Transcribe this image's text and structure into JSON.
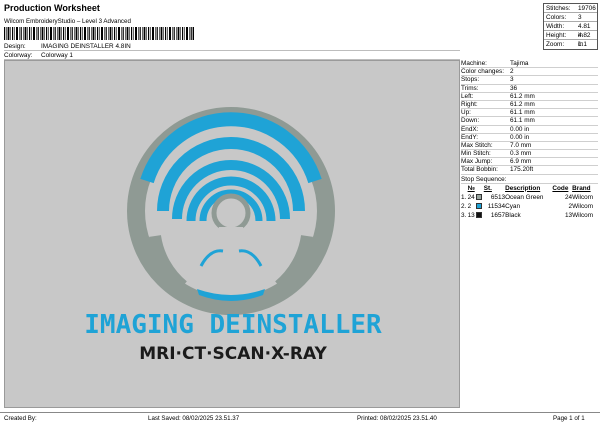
{
  "header": {
    "title": "Production Worksheet",
    "subtitle": "Wilcom EmbroideryStudio – Level 3 Advanced"
  },
  "info": {
    "design_label": "Design:",
    "design_value": "IMAGING DEINSTALLER 4.8IN",
    "colorway_label": "Colorway:",
    "colorway_value": "Colorway 1"
  },
  "stats": [
    {
      "label": "Stitches:",
      "value": "19706"
    },
    {
      "label": "Colors:",
      "value": "3"
    },
    {
      "label": "Width:",
      "value": "4.81 in"
    },
    {
      "label": "Height:",
      "value": "4.82 in"
    },
    {
      "label": "Zoom:",
      "value": "1:1"
    }
  ],
  "machine": [
    {
      "label": "Machine:",
      "value": "Tajima"
    },
    {
      "label": "Color changes:",
      "value": "2"
    },
    {
      "label": "Stops:",
      "value": "3"
    },
    {
      "label": "Trims:",
      "value": "36"
    },
    {
      "label": "Left:",
      "value": "61.2 mm"
    },
    {
      "label": "Right:",
      "value": "61.2 mm"
    },
    {
      "label": "Up:",
      "value": "61.1 mm"
    },
    {
      "label": "Down:",
      "value": "61.1 mm"
    },
    {
      "label": "EndX:",
      "value": "0.00 in"
    },
    {
      "label": "EndY:",
      "value": "0.00 in"
    },
    {
      "label": "Max Stitch:",
      "value": "7.0 mm"
    },
    {
      "label": "Min Stitch:",
      "value": "0.3 mm"
    },
    {
      "label": "Max Jump:",
      "value": "6.9 mm"
    },
    {
      "label": "Total Bobbin:",
      "value": "175.20ft"
    }
  ],
  "stop_sequence": {
    "title": "Stop Sequence:",
    "headers": {
      "n": "№",
      "st": "St.",
      "desc": "Description",
      "code": "Code",
      "brand": "Brand"
    },
    "rows": [
      {
        "idx": "1.",
        "n": "24",
        "color": "#9aa6a0",
        "st": "6513",
        "desc": "Ocean Green",
        "code": "24",
        "brand": "Wilcom"
      },
      {
        "idx": "2.",
        "n": "2",
        "color": "#1fa3d6",
        "st": "11534",
        "desc": "Cyan",
        "code": "2",
        "brand": "Wilcom"
      },
      {
        "idx": "3.",
        "n": "13",
        "color": "#111111",
        "st": "1657",
        "desc": "Black",
        "code": "13",
        "brand": "Wilcom"
      }
    ]
  },
  "design_art": {
    "text_line1": "IMAGING DEINSTALLER",
    "text_line2": "MRI·CT·SCAN·X-RAY",
    "color_grey": "#8f9a94",
    "color_cyan": "#1fa3d6",
    "color_black": "#1b1b1b"
  },
  "footer": {
    "created_by": "Created By:",
    "last_saved": "Last Saved: 08/02/2025 23.51.37",
    "printed": "Printed: 08/02/2025 23.51.40",
    "page": "Page 1 of 1"
  }
}
